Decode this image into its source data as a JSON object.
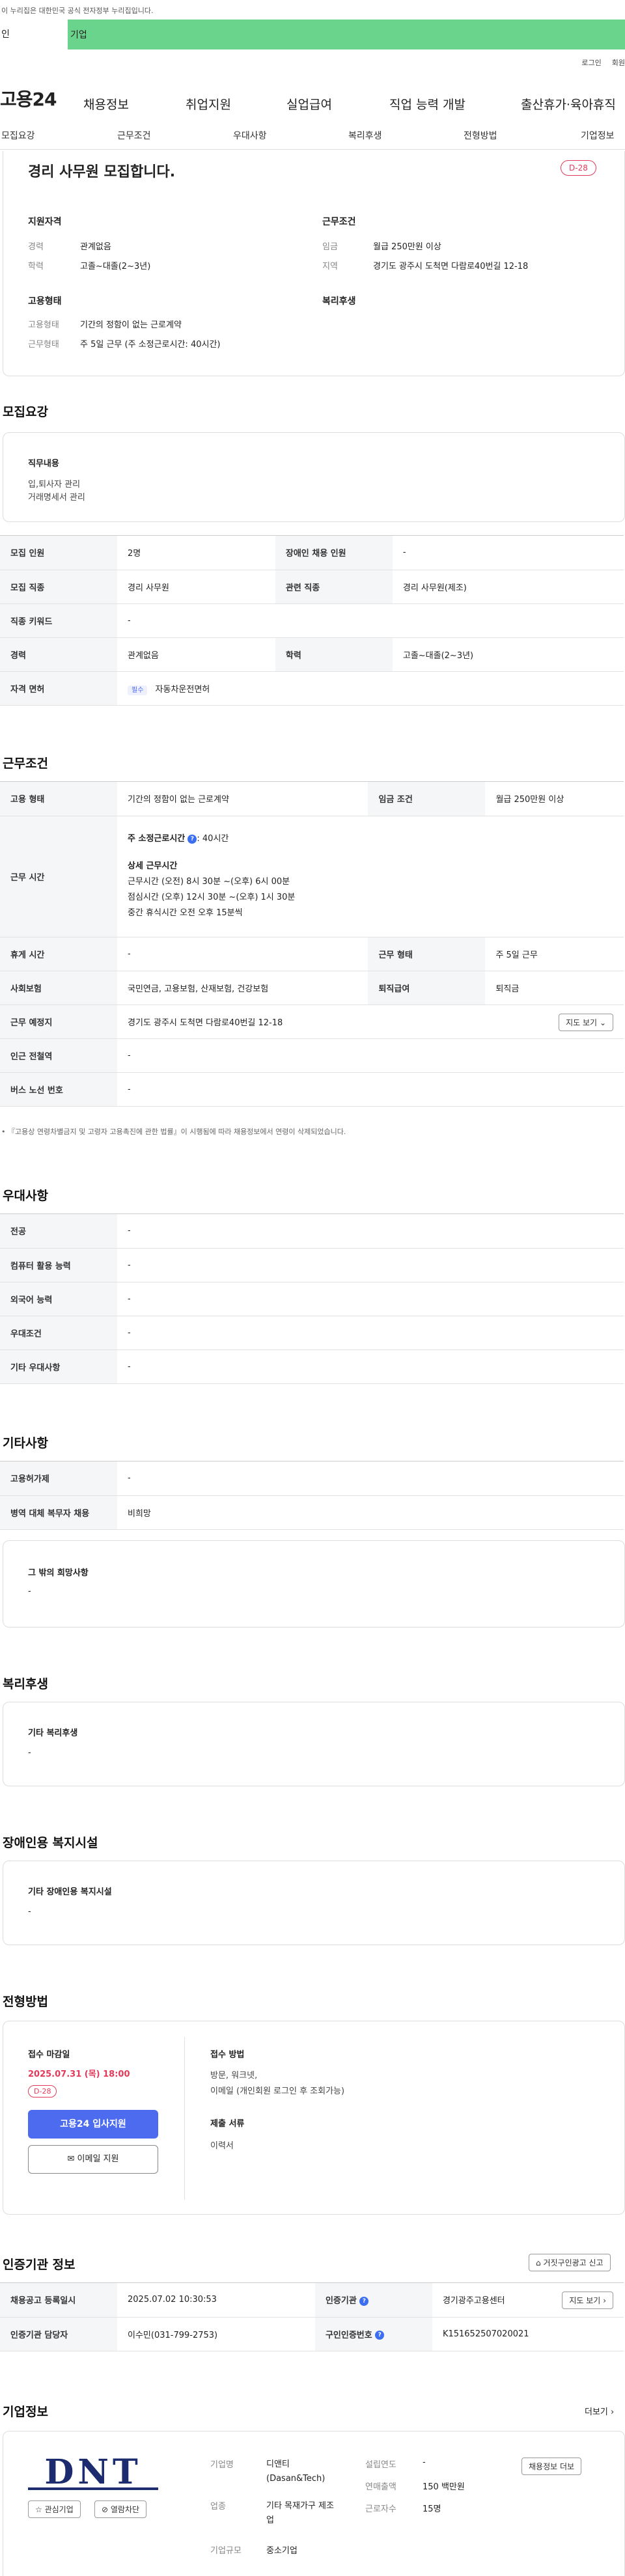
{
  "top": {
    "notice": "이 누리집은 대한민국 공식 전자정부 누리집입니다.",
    "tab_individual": "인",
    "tab_company": "기업",
    "login": "로그인",
    "signup": "회원"
  },
  "gnb": {
    "logo": "고용24",
    "menu": [
      "채용정보",
      "취업지원",
      "실업급여",
      "직업 능력 개발",
      "출산휴가·육아휴직"
    ]
  },
  "subtabs": [
    "모집요강",
    "근무조건",
    "우대사항",
    "복리후생",
    "전형방법",
    "기업정보"
  ],
  "summary": {
    "title": "경리 사무원 모집합니다.",
    "dday": "D-28",
    "qual_title": "지원자격",
    "career_label": "경력",
    "career_value": "관계없음",
    "edu_label": "학력",
    "edu_value": "고졸~대졸(2~3년)",
    "emp_title": "고용형태",
    "emp_type_label": "고용형태",
    "emp_type_value": "기간의 정함이 없는 근로계약",
    "work_type_label": "근무형태",
    "work_type_value": "주 5일 근무 (주 소정근로시간: 40시간)",
    "cond_title": "근무조건",
    "wage_label": "임금",
    "wage_value": "월급 250만원 이상",
    "area_label": "지역",
    "area_value": "경기도 광주시 도척면 다람로40번길 12-18",
    "welfare_title": "복리후생"
  },
  "recruit": {
    "title": "모집요강",
    "duty_title": "직무내용",
    "duty_lines": [
      "입,퇴사자 관리",
      "거래명세서 관리"
    ],
    "rows": [
      {
        "k1": "모집 인원",
        "v1": "2명",
        "k2": "장애인 채용 인원",
        "v2": "-"
      },
      {
        "k1": "모집 직종",
        "v1": "경리 사무원",
        "k2": "관련 직종",
        "v2": "경리 사무원(제조)"
      },
      {
        "k1": "직종 키워드",
        "v1": "-"
      },
      {
        "k1": "경력",
        "v1": "관계없음",
        "k2": "학력",
        "v2": "고졸~대졸(2~3년)"
      },
      {
        "k1": "자격 면허",
        "badge": "필수",
        "v1": "자동차운전면허"
      }
    ]
  },
  "work": {
    "title": "근무조건",
    "emp_type_label": "고용 형태",
    "emp_type_value": "기간의 정함이 없는 근로계약",
    "wage_label": "임금 조건",
    "wage_value": "월급 250만원 이상",
    "hours_label": "근무 시간",
    "hours_main": "주 소정근로시간",
    "hours_main_value": ": 40시간",
    "hours_detail_title": "상세 근무시간",
    "hours_detail": [
      "근무시간 (오전) 8시 30분 ~(오후) 6시 00분",
      "점심시간 (오후) 12시 30분 ~(오후) 1시 30분",
      "중간 휴식시간 오전 오후 15분씩"
    ],
    "break_label": "휴게 시간",
    "break_value": "-",
    "work_form_label": "근무 형태",
    "work_form_value": "주 5일 근무",
    "insurance_label": "사회보험",
    "insurance_value": "국민연금, 고용보험, 산재보험, 건강보험",
    "severance_label": "퇴직급여",
    "severance_value": "퇴직금",
    "place_label": "근무 예정지",
    "place_value": "경기도 광주시 도척면 다람로40번길 12-18",
    "map_btn": "지도 보기",
    "subway_label": "인근 전철역",
    "subway_value": "-",
    "bus_label": "버스 노선 번호",
    "bus_value": "-",
    "footnote": "『고용상 연령차별금지 및 고령자 고용촉진에 관한 법률』이 시행됨에 따라 채용정보에서 연령이 삭제되었습니다."
  },
  "prefer": {
    "title": "우대사항",
    "rows": [
      {
        "k": "전공",
        "v": "-"
      },
      {
        "k": "컴퓨터 활용 능력",
        "v": "-"
      },
      {
        "k": "외국어 능력",
        "v": "-"
      },
      {
        "k": "우대조건",
        "v": "-"
      },
      {
        "k": "기타 우대사항",
        "v": "-"
      }
    ]
  },
  "etc": {
    "title": "기타사항",
    "rows": [
      {
        "k": "고용허가제",
        "v": "-"
      },
      {
        "k": "병역 대체 복무자 채용",
        "v": "비희망"
      }
    ],
    "other_title": "그 밖의 희망사항",
    "other_value": "-"
  },
  "welfare": {
    "title": "복리후생",
    "box_title": "기타 복리후생",
    "box_value": "-"
  },
  "disability": {
    "title": "장애인용 복지시설",
    "box_title": "기타 장애인용 복지시설",
    "box_value": "-"
  },
  "selection": {
    "title": "전형방법",
    "deadline_title": "접수 마감일",
    "deadline_value": "2025.07.31 (목) 18:00",
    "dday": "D-28",
    "apply_btn": "고용24 입사지원",
    "email_btn": "이메일 지원",
    "method_title": "접수 방법",
    "method_lines": [
      "방문, 워크넷,",
      "이메일 (개인회원 로그인 후 조회가능)"
    ],
    "docs_title": "제출 서류",
    "docs_value": "이력서"
  },
  "agency": {
    "title": "인증기관 정보",
    "report_btn": "거짓구인광고 신고",
    "reg_label": "채용공고 등록일시",
    "reg_value": "2025.07.02 10:30:53",
    "org_label": "인증기관",
    "org_value": "경기광주고용센터",
    "map_btn": "지도 보기",
    "staff_label": "인증기관 담당자",
    "staff_value": "이수민(031-799-2753)",
    "cert_label": "구인인증번호",
    "cert_value": "K151652507020021"
  },
  "company": {
    "title": "기업정보",
    "more": "더보기",
    "fav_btn": "관심기업",
    "block_btn": "열람차단",
    "name_label": "기업명",
    "name_value": "디앤티(Dasan&Tech)",
    "found_label": "설립연도",
    "found_value": "-",
    "industry_label": "업종",
    "industry_value": "기타 목재가구 제조업",
    "sales_label": "연매출액",
    "sales_value": "150 백만원",
    "emp_label": "근로자수",
    "emp_value": "15명",
    "size_label": "기업규모",
    "size_value": "중소기업",
    "other_jobs_btn": "채용정보 더보",
    "logo_text": "DNT"
  },
  "colors": {
    "green": "#6ad48c",
    "accent_red": "#e23a5a",
    "button_blue": "#4d6bef"
  }
}
